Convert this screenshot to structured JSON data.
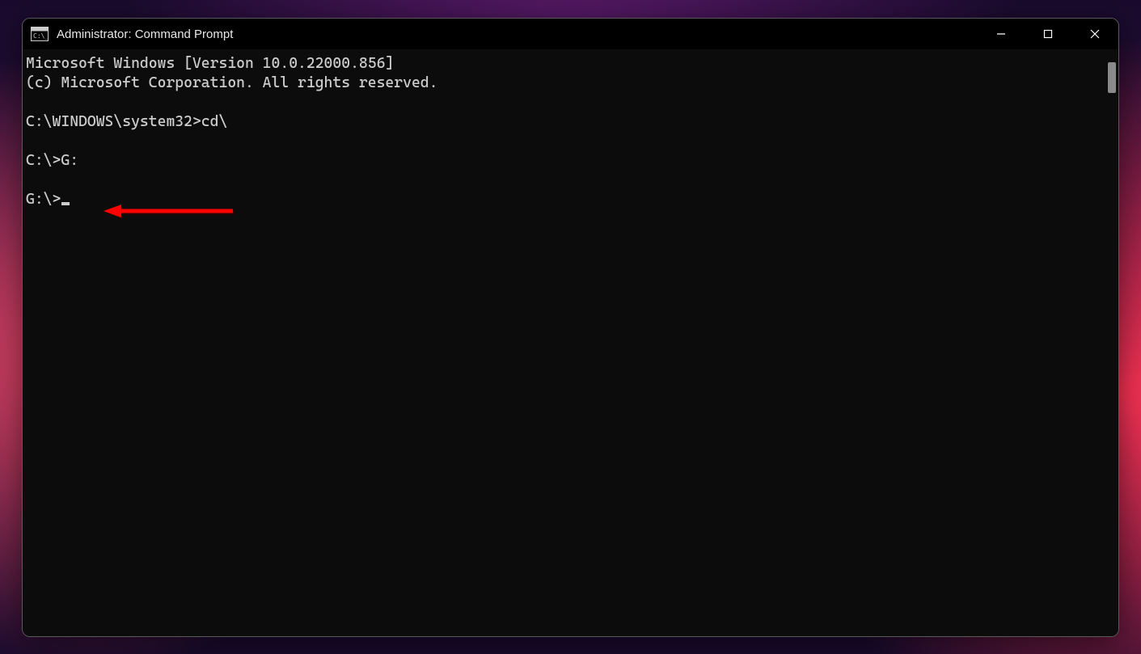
{
  "window": {
    "title": "Administrator: Command Prompt"
  },
  "terminal": {
    "lines": [
      "Microsoft Windows [Version 10.0.22000.856]",
      "(c) Microsoft Corporation. All rights reserved.",
      "",
      "C:\\WINDOWS\\system32>cd\\",
      "",
      "C:\\>G:",
      "",
      "G:\\>"
    ],
    "cursor_after_last": true
  },
  "annotation": {
    "type": "arrow",
    "color": "#ff0000",
    "points_to": "C:\\>G:"
  }
}
